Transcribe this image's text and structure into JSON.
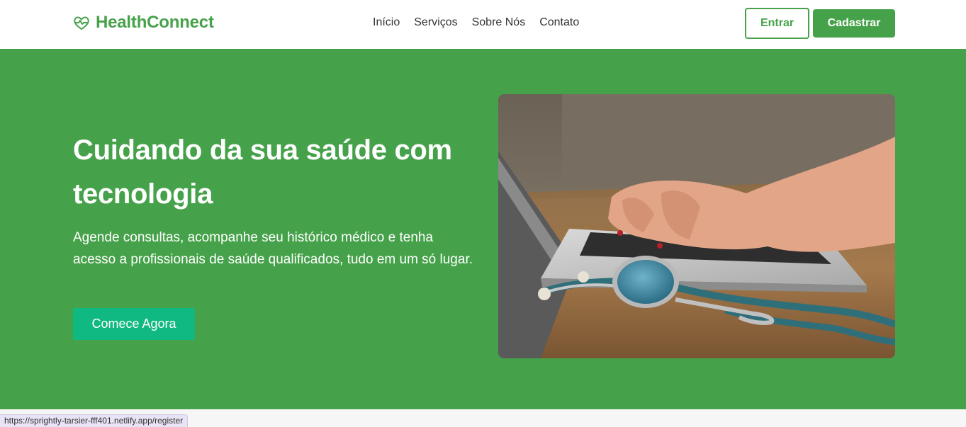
{
  "brand": {
    "name": "HealthConnect",
    "icon": "heart-pulse-icon",
    "color": "#46a24a"
  },
  "nav": {
    "items": [
      {
        "label": "Início"
      },
      {
        "label": "Serviços"
      },
      {
        "label": "Sobre Nós"
      },
      {
        "label": "Contato"
      }
    ]
  },
  "auth": {
    "login_label": "Entrar",
    "register_label": "Cadastrar"
  },
  "hero": {
    "title": "Cuidando da sua saúde com tecnologia",
    "subtitle": "Agende consultas, acompanhe seu histórico médico e tenha acesso a profissionais de saúde qualificados, tudo em um só lugar.",
    "cta_label": "Comece Agora",
    "background": "#46a24a",
    "cta_color": "#10b981",
    "image_alt": "hands-typing-laptop-with-stethoscope"
  },
  "status_url": "https://sprightly-tarsier-fff401.netlify.app/register"
}
